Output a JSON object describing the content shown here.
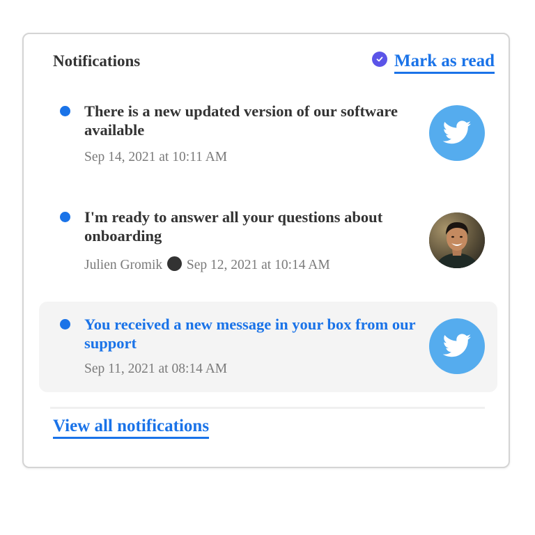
{
  "header": {
    "title": "Notifications",
    "mark_read_label": "Mark as read"
  },
  "notifications": [
    {
      "text": "There is a new updated version of our software available",
      "meta": "Sep 14, 2021 at 10:11 AM",
      "avatar": "twitter-icon",
      "unread": true
    },
    {
      "text": "I'm ready to answer all your questions about onboarding",
      "author": "Julien Gromik",
      "date": "Sep 12, 2021 at 10:14 AM",
      "avatar": "person-photo",
      "unread": true
    },
    {
      "text": "You received a new message in your box from our support",
      "meta": "Sep 11, 2021 at 08:14 AM",
      "avatar": "twitter-icon",
      "unread": true,
      "highlighted": true
    }
  ],
  "footer": {
    "view_all_label": "View all notifications"
  },
  "colors": {
    "accent": "#1a73e8",
    "check_badge": "#5b54e8",
    "twitter": "#55acee",
    "text": "#333333",
    "muted": "#7a7a7a",
    "highlight_bg": "#f4f4f4"
  }
}
